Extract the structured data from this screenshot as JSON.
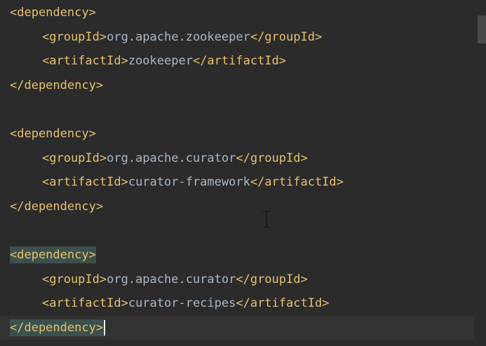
{
  "editor": {
    "lines": [
      {
        "indent": 0,
        "open": "<dependency>",
        "text": "",
        "close": ""
      },
      {
        "indent": 1,
        "open": "<groupId>",
        "text": "org.apache.zookeeper",
        "close": "</groupId>"
      },
      {
        "indent": 1,
        "open": "<artifactId>",
        "text": "zookeeper",
        "close": "</artifactId>"
      },
      {
        "indent": 0,
        "open": "</dependency>",
        "text": "",
        "close": ""
      },
      {
        "indent": 0,
        "open": "",
        "text": "",
        "close": ""
      },
      {
        "indent": 0,
        "open": "<dependency>",
        "text": "",
        "close": ""
      },
      {
        "indent": 1,
        "open": "<groupId>",
        "text": "org.apache.curator",
        "close": "</groupId>"
      },
      {
        "indent": 1,
        "open": "<artifactId>",
        "text": "curator-framework",
        "close": "</artifactId>"
      },
      {
        "indent": 0,
        "open": "</dependency>",
        "text": "",
        "close": ""
      },
      {
        "indent": 0,
        "open": "",
        "text": "",
        "close": ""
      },
      {
        "indent": 0,
        "open": "<dependency>",
        "text": "",
        "close": "",
        "highlight": true
      },
      {
        "indent": 1,
        "open": "<groupId>",
        "text": "org.apache.curator",
        "close": "</groupId>"
      },
      {
        "indent": 1,
        "open": "<artifactId>",
        "text": "curator-recipes",
        "close": "</artifactId>"
      },
      {
        "indent": 0,
        "open": "</dependency>",
        "text": "",
        "close": "",
        "highlight": true,
        "current": true,
        "caret": true
      }
    ]
  },
  "colors": {
    "background": "#2b2b2b",
    "tag": "#e8bf6a",
    "text": "#a9b7c6",
    "match_highlight": "#3b514d",
    "current_line": "#323232"
  }
}
